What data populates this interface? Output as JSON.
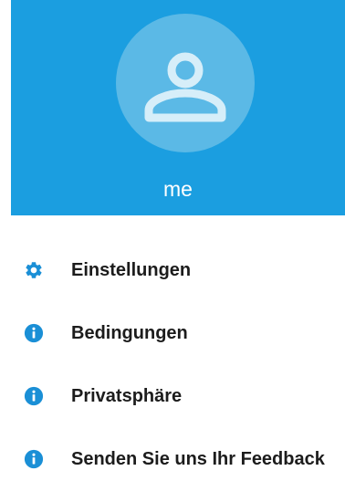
{
  "profile": {
    "name": "me",
    "avatar_icon": "person-icon"
  },
  "colors": {
    "header": "#1b9ee0",
    "avatar_circle": "#5bb9e6",
    "icon": "#1a8fd6",
    "label": "#1c1c1c"
  },
  "menu": {
    "items": [
      {
        "label": "Einstellungen",
        "icon": "gear-icon"
      },
      {
        "label": "Bedingungen",
        "icon": "info-icon"
      },
      {
        "label": "Privatsphäre",
        "icon": "info-icon"
      },
      {
        "label": "Senden Sie uns Ihr Feedback",
        "icon": "info-icon"
      }
    ]
  }
}
